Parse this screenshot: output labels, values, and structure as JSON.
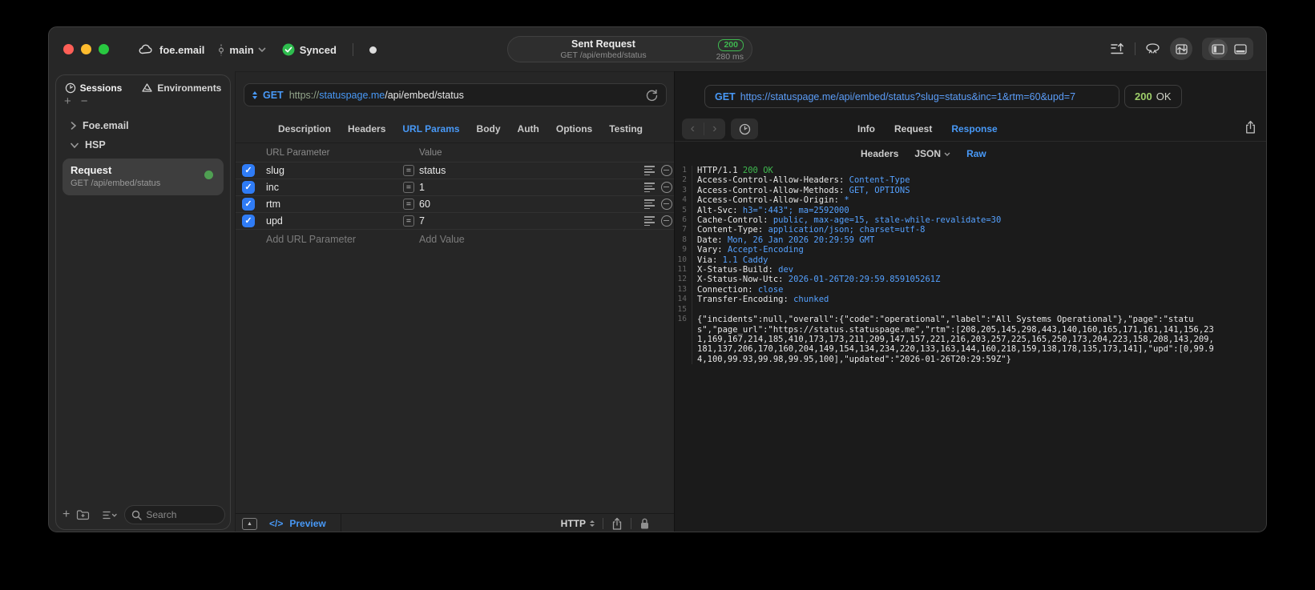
{
  "titlebar": {
    "project_name": "foe.email",
    "branch_name": "main",
    "sync_label": "Synced",
    "sent_request": {
      "title": "Sent Request",
      "subtitle": "GET /api/embed/status",
      "status_code": "200",
      "duration": "280 ms"
    }
  },
  "sidebar": {
    "tabs": [
      {
        "label": "Sessions"
      },
      {
        "label": "Environments"
      }
    ],
    "tree": [
      {
        "label": "Foe.email"
      },
      {
        "label": "HSP"
      }
    ],
    "request_item": {
      "title": "Request",
      "subtitle": "GET /api/embed/status"
    },
    "search_placeholder": "Search"
  },
  "request_panel": {
    "method": "GET",
    "url": {
      "scheme": "https://",
      "host": "statuspage.me",
      "path": "/api/embed/status"
    },
    "tabs": [
      "Description",
      "Headers",
      "URL Params",
      "Body",
      "Auth",
      "Options",
      "Testing"
    ],
    "active_tab": "URL Params",
    "params_table": {
      "columns": [
        "URL Parameter",
        "Value"
      ],
      "rows": [
        {
          "name": "slug",
          "value": "status",
          "checked": true
        },
        {
          "name": "inc",
          "value": "1",
          "checked": true
        },
        {
          "name": "rtm",
          "value": "60",
          "checked": true
        },
        {
          "name": "upd",
          "value": "7",
          "checked": true
        }
      ],
      "add_name_placeholder": "Add URL Parameter",
      "add_value_placeholder": "Add Value"
    },
    "footer": {
      "preview_icon": "</>",
      "preview_label": "Preview",
      "protocol": "HTTP"
    }
  },
  "response_panel": {
    "method": "GET",
    "url": "https://statuspage.me/api/embed/status?slug=status&inc=1&rtm=60&upd=7",
    "status_code": "200",
    "status_text": "OK",
    "tabs": [
      "Info",
      "Request",
      "Response"
    ],
    "active_tab": "Response",
    "subtabs": [
      "Headers",
      "JSON",
      "Raw"
    ],
    "active_subtab": "Raw",
    "body_lines": [
      {
        "n": "1",
        "parts": [
          {
            "t": "HTTP/1.1 ",
            "c": "w"
          },
          {
            "t": "200 OK",
            "c": "g"
          }
        ]
      },
      {
        "n": "2",
        "parts": [
          {
            "t": "Access-Control-Allow-Headers: ",
            "c": "w"
          },
          {
            "t": "Content-Type",
            "c": "b"
          }
        ]
      },
      {
        "n": "3",
        "parts": [
          {
            "t": "Access-Control-Allow-Methods: ",
            "c": "w"
          },
          {
            "t": "GET, OPTIONS",
            "c": "b"
          }
        ]
      },
      {
        "n": "4",
        "parts": [
          {
            "t": "Access-Control-Allow-Origin: ",
            "c": "w"
          },
          {
            "t": "*",
            "c": "b"
          }
        ]
      },
      {
        "n": "5",
        "parts": [
          {
            "t": "Alt-Svc: ",
            "c": "w"
          },
          {
            "t": "h3=\":443\"; ma=2592000",
            "c": "b"
          }
        ]
      },
      {
        "n": "6",
        "parts": [
          {
            "t": "Cache-Control: ",
            "c": "w"
          },
          {
            "t": "public, max-age=15, stale-while-revalidate=30",
            "c": "b"
          }
        ]
      },
      {
        "n": "7",
        "parts": [
          {
            "t": "Content-Type: ",
            "c": "w"
          },
          {
            "t": "application/json; charset=utf-8",
            "c": "b"
          }
        ]
      },
      {
        "n": "8",
        "parts": [
          {
            "t": "Date: ",
            "c": "w"
          },
          {
            "t": "Mon, 26 Jan 2026 20:29:59 GMT",
            "c": "b"
          }
        ]
      },
      {
        "n": "9",
        "parts": [
          {
            "t": "Vary: ",
            "c": "w"
          },
          {
            "t": "Accept-Encoding",
            "c": "b"
          }
        ]
      },
      {
        "n": "10",
        "parts": [
          {
            "t": "Via: ",
            "c": "w"
          },
          {
            "t": "1.1 Caddy",
            "c": "b"
          }
        ]
      },
      {
        "n": "11",
        "parts": [
          {
            "t": "X-Status-Build: ",
            "c": "w"
          },
          {
            "t": "dev",
            "c": "b"
          }
        ]
      },
      {
        "n": "12",
        "parts": [
          {
            "t": "X-Status-Now-Utc: ",
            "c": "w"
          },
          {
            "t": "2026-01-26T20:29:59.859105261Z",
            "c": "b"
          }
        ]
      },
      {
        "n": "13",
        "parts": [
          {
            "t": "Connection: ",
            "c": "w"
          },
          {
            "t": "close",
            "c": "b"
          }
        ]
      },
      {
        "n": "14",
        "parts": [
          {
            "t": "Transfer-Encoding: ",
            "c": "w"
          },
          {
            "t": "chunked",
            "c": "b"
          }
        ]
      },
      {
        "n": "15",
        "parts": []
      },
      {
        "n": "16",
        "wrap": true,
        "parts": [
          {
            "t": "{\"incidents\":null,\"overall\":{\"code\":\"operational\",\"label\":\"All Systems Operational\"},\"page\":\"status\",\"page_url\":\"https://status.statuspage.me\",\"rtm\":[208,205,145,298,443,140,160,165,171,161,141,156,231,169,167,214,185,410,173,173,211,209,147,157,221,216,203,257,225,165,250,173,204,223,158,208,143,209,181,137,206,170,160,204,149,154,134,234,220,133,163,144,160,218,159,138,178,135,173,141],\"upd\":[0,99.94,100,99.93,99.98,99.95,100],\"updated\":\"2026-01-26T20:29:59Z\"}",
            "c": "w"
          }
        ]
      }
    ]
  },
  "colors": {
    "accent_blue": "#4899f7",
    "sync_green": "#2ebd4e",
    "status_badge_green": "#3fb950",
    "response_status_green": "#9ece6a",
    "header_value_blue": "#55a1ff",
    "checkbox_blue": "#2f7cf6"
  }
}
